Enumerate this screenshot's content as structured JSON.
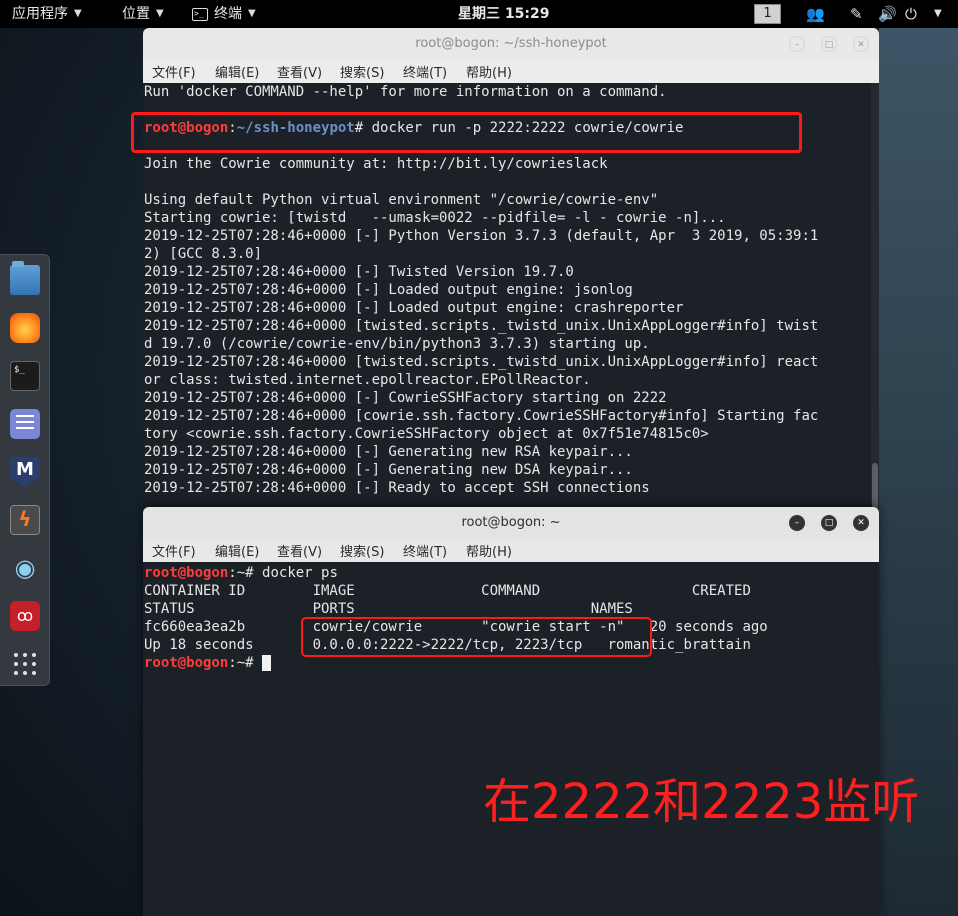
{
  "topbar": {
    "apps": "应用程序",
    "places": "位置",
    "terminal": "终端",
    "clock": "星期三 15:29",
    "workspace": "1"
  },
  "window1": {
    "title": "root@bogon: ~/ssh-honeypot",
    "menu": [
      "文件(F)",
      "编辑(E)",
      "查看(V)",
      "搜索(S)",
      "终端(T)",
      "帮助(H)"
    ],
    "prompt_user": "root@bogon",
    "prompt_sep": ":",
    "prompt_path": "~/ssh-honeypot",
    "prompt_suffix": "# ",
    "command": "docker run -p 2222:2222 cowrie/cowrie",
    "line_before": "Run 'docker COMMAND --help' for more information on a command.",
    "lines_after": [
      "Join the Cowrie community at: http://bit.ly/cowrieslack",
      "",
      "Using default Python virtual environment \"/cowrie/cowrie-env\"",
      "Starting cowrie: [twistd   --umask=0022 --pidfile= -l - cowrie -n]...",
      "2019-12-25T07:28:46+0000 [-] Python Version 3.7.3 (default, Apr  3 2019, 05:39:1",
      "2) [GCC 8.3.0]",
      "2019-12-25T07:28:46+0000 [-] Twisted Version 19.7.0",
      "2019-12-25T07:28:46+0000 [-] Loaded output engine: jsonlog",
      "2019-12-25T07:28:46+0000 [-] Loaded output engine: crashreporter",
      "2019-12-25T07:28:46+0000 [twisted.scripts._twistd_unix.UnixAppLogger#info] twist",
      "d 19.7.0 (/cowrie/cowrie-env/bin/python3 3.7.3) starting up.",
      "2019-12-25T07:28:46+0000 [twisted.scripts._twistd_unix.UnixAppLogger#info] react",
      "or class: twisted.internet.epollreactor.EPollReactor.",
      "2019-12-25T07:28:46+0000 [-] CowrieSSHFactory starting on 2222",
      "2019-12-25T07:28:46+0000 [cowrie.ssh.factory.CowrieSSHFactory#info] Starting fac",
      "tory <cowrie.ssh.factory.CowrieSSHFactory object at 0x7f51e74815c0>",
      "2019-12-25T07:28:46+0000 [-] Generating new RSA keypair...",
      "2019-12-25T07:28:46+0000 [-] Generating new DSA keypair...",
      "2019-12-25T07:28:46+0000 [-] Ready to accept SSH connections"
    ]
  },
  "window2": {
    "title": "root@bogon: ~",
    "menu": [
      "文件(F)",
      "编辑(E)",
      "查看(V)",
      "搜索(S)",
      "终端(T)",
      "帮助(H)"
    ],
    "prompt_user": "root@bogon",
    "prompt_sep": ":",
    "prompt_path": "~",
    "prompt_suffix": "# ",
    "command": "docker ps",
    "output": [
      "CONTAINER ID        IMAGE               COMMAND                  CREATED",
      "STATUS              PORTS                            NAMES",
      "fc660ea3ea2b        cowrie/cowrie       \"cowrie start -n\"   20 seconds ago",
      "Up 18 seconds       0.0.0.0:2222->2222/tcp, 2223/tcp   romantic_brattain"
    ]
  },
  "annotation": {
    "note": "在2222和2223监听",
    "color": "#ff1f1f"
  },
  "icons": {
    "dock": [
      "files-icon",
      "firefox-icon",
      "terminal-icon",
      "notes-icon",
      "metasploit-icon",
      "burp-icon",
      "eye-icon",
      "cherrytree-icon",
      "app-grid-icon"
    ],
    "tray": [
      "people-icon",
      "pen-icon",
      "volume-icon",
      "power-icon",
      "caret-down-icon"
    ]
  }
}
